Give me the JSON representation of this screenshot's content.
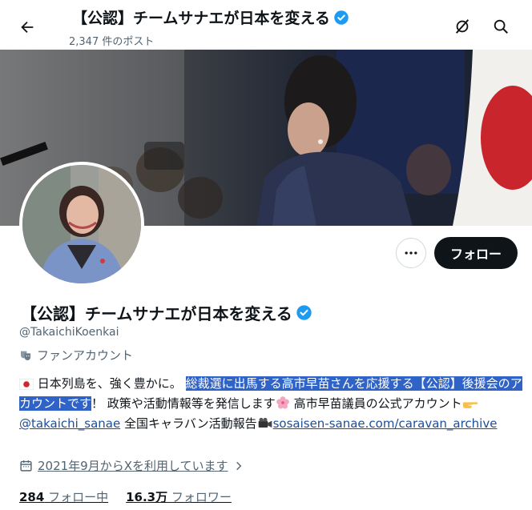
{
  "header": {
    "title": "【公認】チームサナエが日本を変える",
    "post_count": "2,347 件のポスト"
  },
  "profile": {
    "name": "【公認】チームサナエが日本を変える",
    "handle": "@TakaichiKoenkai",
    "category": "ファンアカウント",
    "follow_label": "フォロー",
    "bio": {
      "part1": "日本列島を、強く豊かに。",
      "highlight": "総裁選に出馬する高市早苗さんを応援する【公認】後援会のアカウントです",
      "part2": "！ 政策や活動情報等を発信します",
      "part3": " 高市早苗議員の公式アカウント",
      "mention": "@takaichi_sanae",
      "part4": " 全国キャラバン活動報告",
      "link": "sosaisen-sanae.com/caravan_archive"
    },
    "joined": "2021年9月からXを利用しています",
    "following_count": "284",
    "following_label": "フォロー中",
    "followers_count": "16.3万",
    "followers_label": "フォロワー"
  },
  "colors": {
    "accent": "#1d9bf0",
    "follow_button": "#0f1419",
    "selection": "#2f63c7",
    "secondary_text": "#536471"
  },
  "icons": [
    "back-arrow-icon",
    "verified-badge-icon",
    "grok-icon",
    "search-icon",
    "more-icon",
    "theater-mask-icon",
    "calendar-icon",
    "chevron-right-icon",
    "japan-flag-icon",
    "cherry-blossom-icon",
    "pointing-hand-icon",
    "camera-icon"
  ]
}
